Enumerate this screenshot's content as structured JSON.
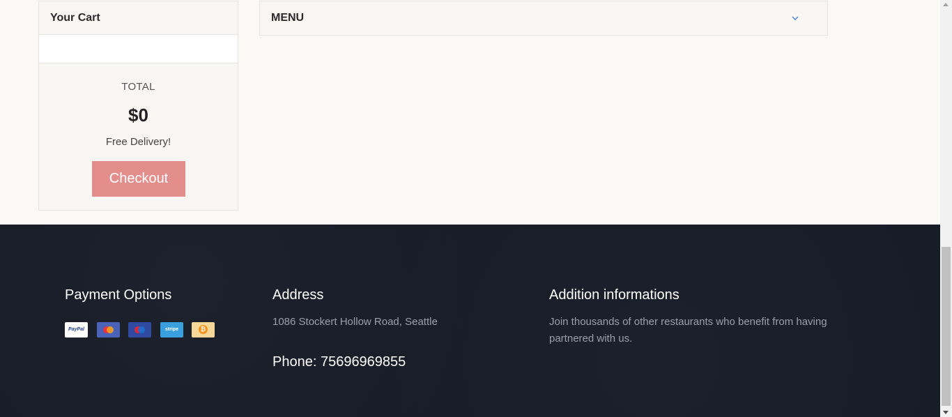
{
  "cart": {
    "title": "Your Cart",
    "total_label": "TOTAL",
    "total_value": "$0",
    "delivery_note": "Free Delivery!",
    "checkout_label": "Checkout",
    "checkout_color": "#e48e8c"
  },
  "menu": {
    "label": "MENU",
    "chevron_icon": "chevron-down-icon"
  },
  "footer": {
    "background": "#171c27",
    "payment": {
      "heading": "Payment Options",
      "methods": [
        {
          "icon": "paypal-icon",
          "label": "PayPal"
        },
        {
          "icon": "mastercard-icon",
          "label": ""
        },
        {
          "icon": "maestro-icon",
          "label": ""
        },
        {
          "icon": "stripe-icon",
          "label": "stripe"
        },
        {
          "icon": "bitcoin-icon",
          "label": "₿"
        }
      ]
    },
    "address": {
      "heading": "Address",
      "street": "1086 Stockert Hollow Road, Seattle",
      "phone": "Phone: 75696969855"
    },
    "info": {
      "heading": "Addition informations",
      "text": "Join thousands of other restaurants who benefit from having partnered with us."
    }
  }
}
